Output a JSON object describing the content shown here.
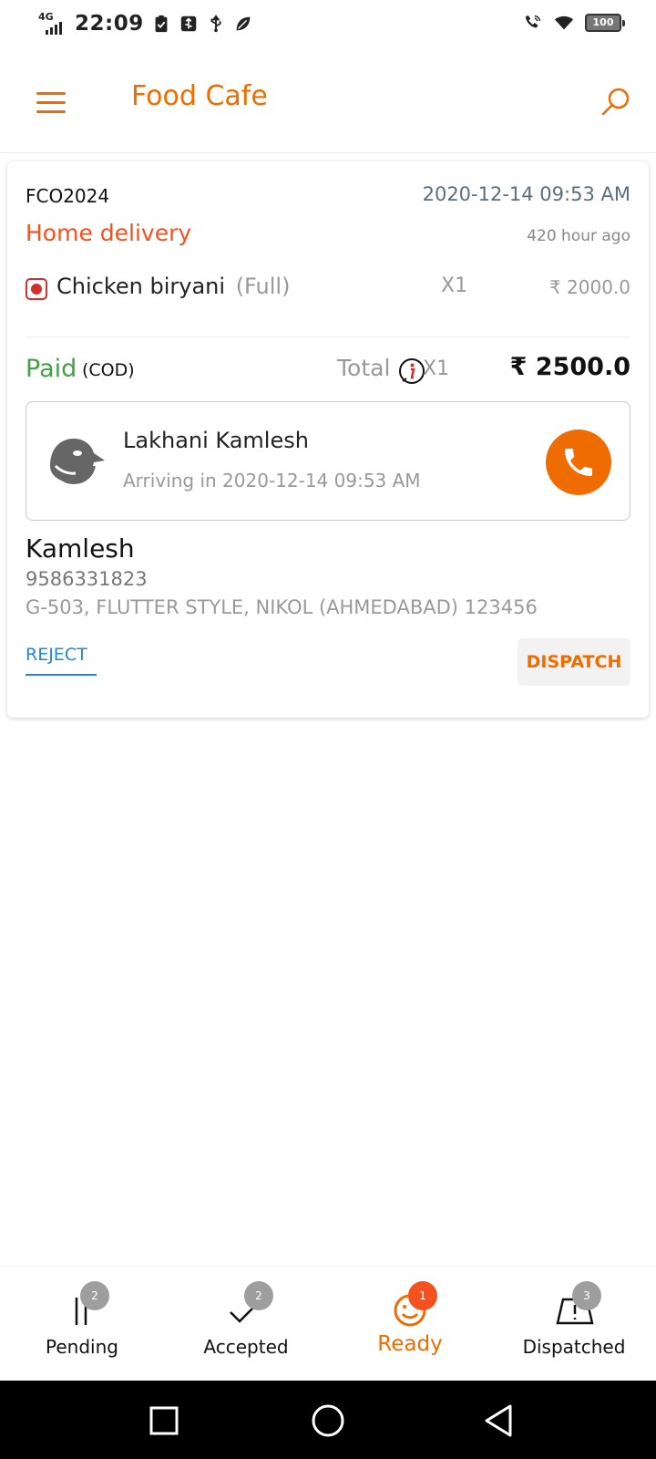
{
  "status_bar": {
    "network": "4G",
    "time": "22:09",
    "battery": "100"
  },
  "app_bar": {
    "title": "Food Cafe"
  },
  "order": {
    "id": "FCO2024",
    "date": "2020-12-14 09:53 AM",
    "delivery_type": "Home delivery",
    "time_ago": "420 hour ago",
    "items": [
      {
        "name": "Chicken biryani",
        "variant": "(Full)",
        "qty": "X1",
        "price": "₹ 2000.0"
      }
    ],
    "payment_status": "Paid",
    "payment_mode": "(COD)",
    "total_label": "Total",
    "total_qty": "X1",
    "total_amount": "₹ 2500.0",
    "rider": {
      "name": "Lakhani Kamlesh",
      "eta": "Arriving in 2020-12-14 09:53 AM"
    },
    "customer": {
      "name": "Kamlesh",
      "phone": "9586331823",
      "address": "G-503, FLUTTER STYLE, NIKOL (AHMEDABAD) 123456"
    },
    "actions": {
      "reject_label": "REJECT",
      "dispatch_label": "DISPATCH"
    }
  },
  "bottom_nav": {
    "tabs": [
      {
        "label": "Pending",
        "badge": "2",
        "icon": "pause-icon",
        "active": false
      },
      {
        "label": "Accepted",
        "badge": "2",
        "icon": "check-icon",
        "active": false
      },
      {
        "label": "Ready",
        "badge": "1",
        "icon": "smile-icon",
        "active": true
      },
      {
        "label": "Dispatched",
        "badge": "3",
        "icon": "delivery-icon",
        "active": false
      }
    ]
  },
  "colors": {
    "accent": "#ef6c00",
    "delivery": "#f4511e",
    "paid": "#43a047",
    "reject": "#1e88e5"
  }
}
